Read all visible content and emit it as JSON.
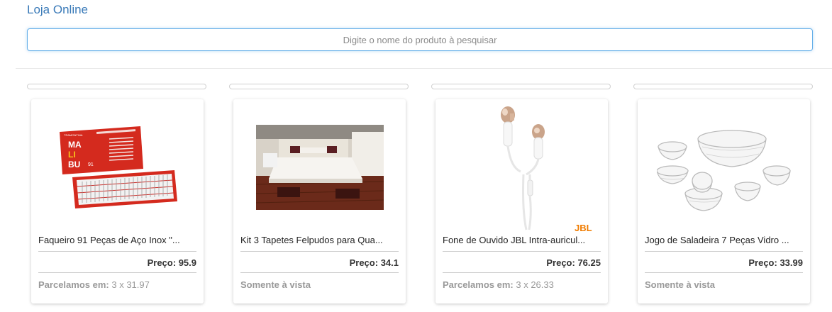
{
  "header": {
    "brand": "Loja Online"
  },
  "search": {
    "placeholder": "Digite o nome do produto à pesquisar",
    "value": ""
  },
  "products": [
    {
      "name": "Faqueiro 91 Peças de Aço Inox \"...",
      "price_label": "Preço:",
      "price": "95.9",
      "payment_label": "Parcelamos em:",
      "payment_detail": "3 x 31.97",
      "image_box_text_1": "MA",
      "image_box_text_2": "LI",
      "image_box_text_3": "BU",
      "image_box_number": "91",
      "image_brand": "TRAMONTINA"
    },
    {
      "name": "Kit 3 Tapetes Felpudos para Qua...",
      "price_label": "Preço:",
      "price": "34.1",
      "payment_label": "Somente à vista",
      "payment_detail": ""
    },
    {
      "name": "Fone de Ouvido JBL Intra-auricul...",
      "price_label": "Preço:",
      "price": "76.25",
      "payment_label": "Parcelamos em:",
      "payment_detail": "3 x 26.33",
      "image_brand": "JBL"
    },
    {
      "name": "Jogo de Saladeira 7 Peças Vidro ...",
      "price_label": "Preço:",
      "price": "33.99",
      "payment_label": "Somente à vista",
      "payment_detail": ""
    }
  ],
  "colors": {
    "brand": "#3a7ab8",
    "search_focus": "#66afe9",
    "box_red": "#d42a1e"
  }
}
